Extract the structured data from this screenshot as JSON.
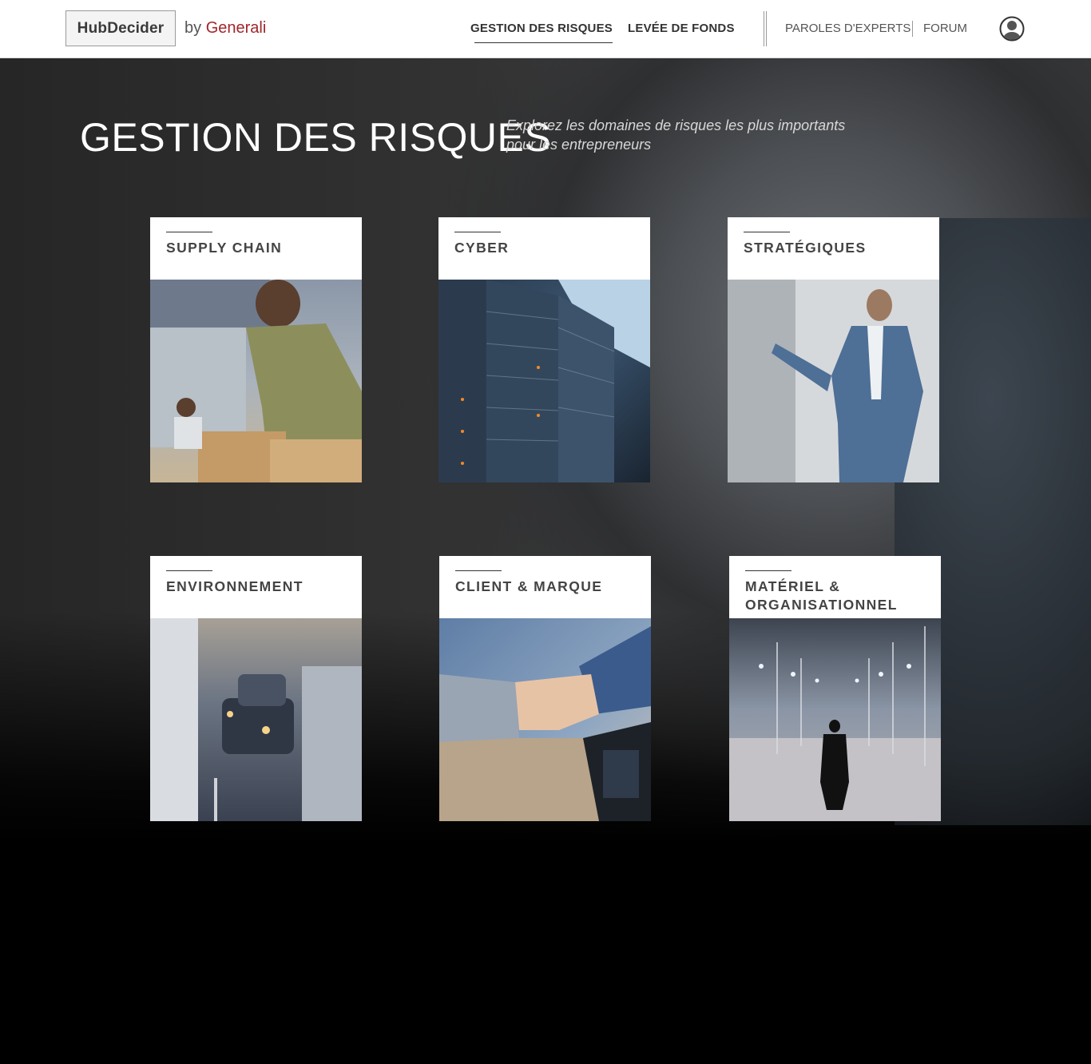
{
  "header": {
    "logo": "HubDecider",
    "by": "by",
    "brand": "Generali",
    "nav_primary": [
      "GESTION DES RISQUES",
      "LEVÉE DE FONDS"
    ],
    "nav_secondary": [
      "PAROLES D'EXPERTS",
      "FORUM"
    ],
    "user_icon": "user-circle-icon"
  },
  "page": {
    "title": "GESTION DES RISQUES",
    "subtitle": "Explorez les domaines de risques les plus importants pour les entrepreneurs"
  },
  "cards": [
    {
      "title": "SUPPLY CHAIN"
    },
    {
      "title": "CYBER"
    },
    {
      "title": "STRATÉGIQUES"
    },
    {
      "title": "ENVIRONNEMENT"
    },
    {
      "title": "CLIENT & MARQUE"
    },
    {
      "title": "MATÉRIEL & ORGANISATIONNEL"
    }
  ],
  "colors": {
    "brand": "#a1262c",
    "header_bg": "#ffffff",
    "hero_bottom": "#000000"
  }
}
